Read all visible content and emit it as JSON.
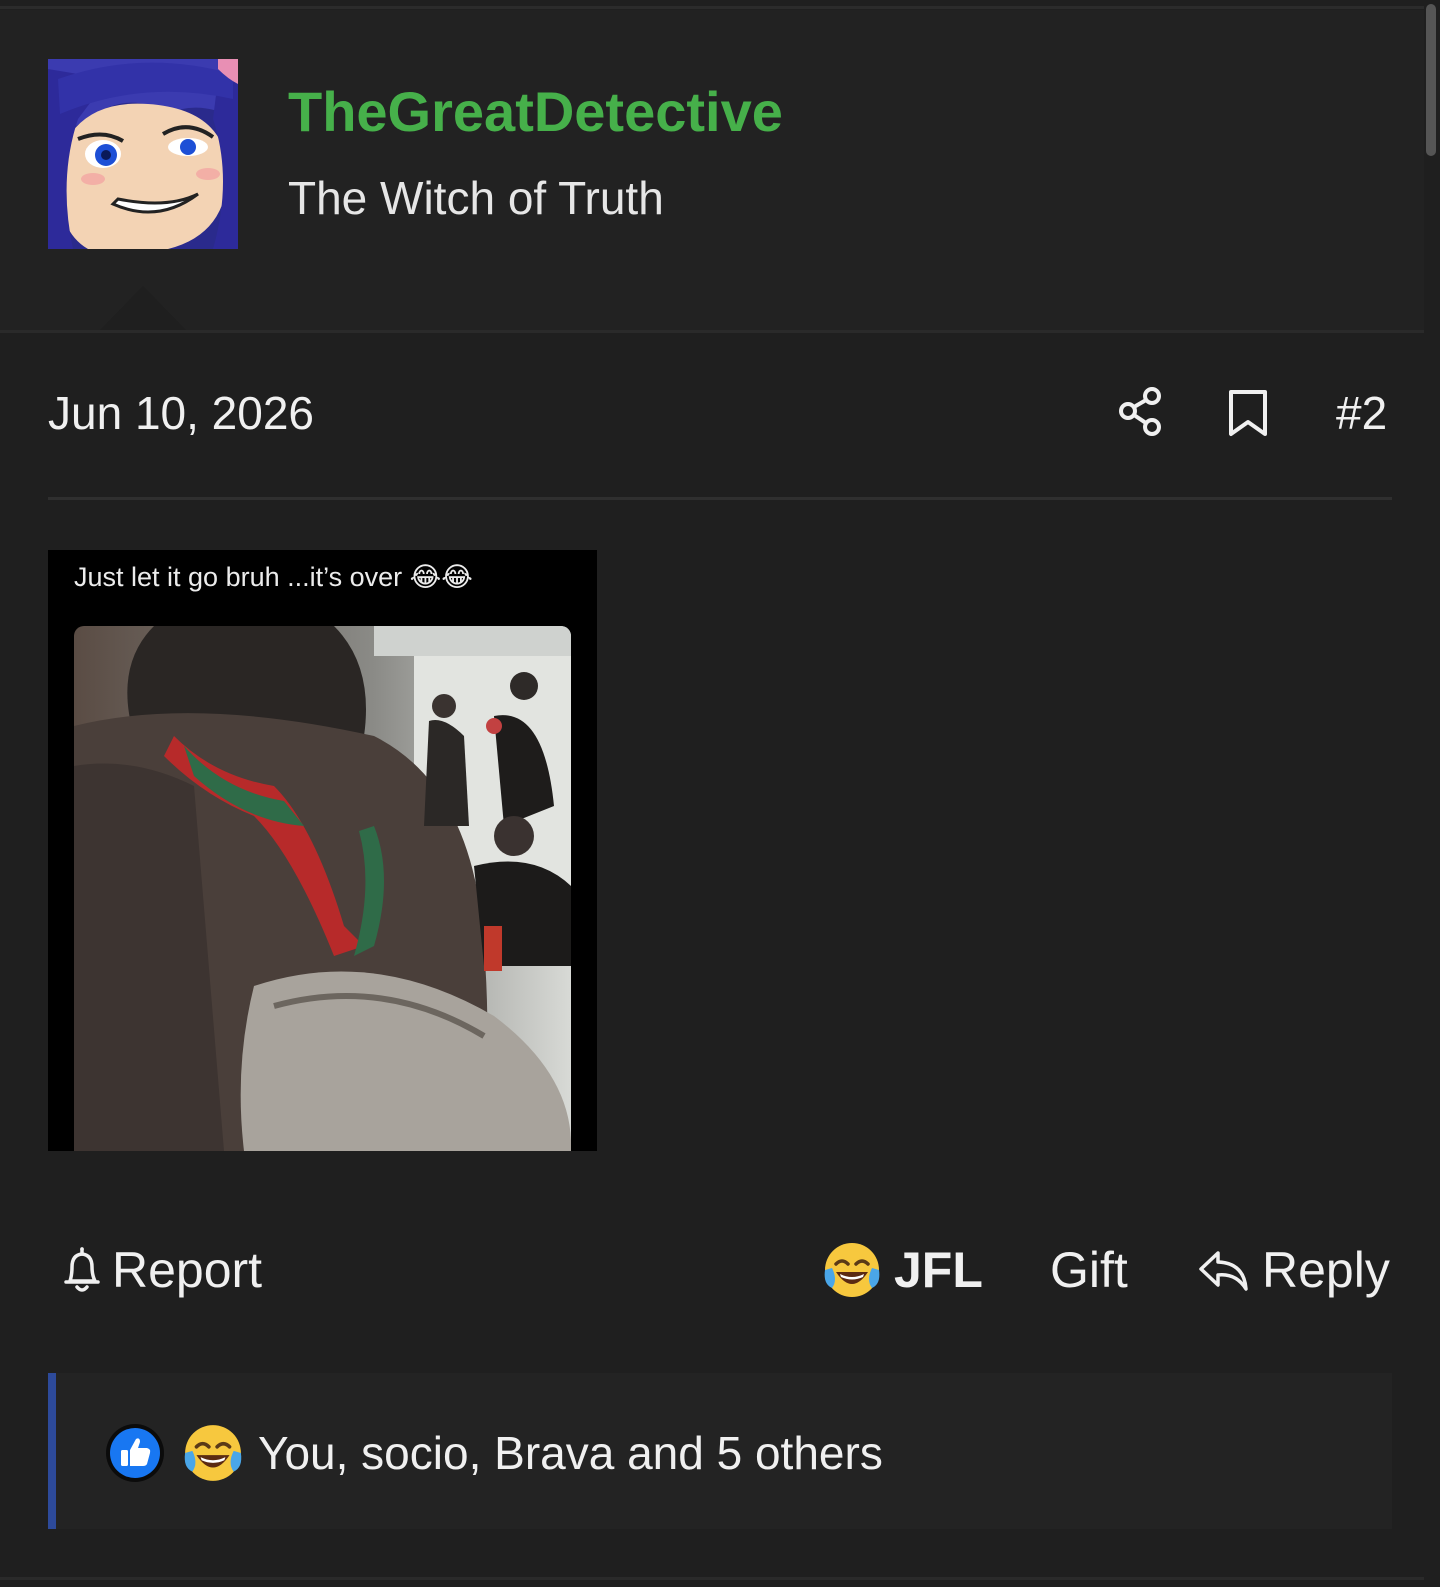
{
  "user": {
    "name": "TheGreatDetective",
    "title": "The Witch of Truth",
    "name_color": "#46b04a"
  },
  "post": {
    "date": "Jun 10, 2026",
    "number": "#2",
    "media_caption": "Just let it go bruh ...it’s over 😂😂"
  },
  "actions": {
    "report": "Report",
    "jfl": "JFL",
    "gift": "Gift",
    "reply": "Reply"
  },
  "reactions": {
    "summary": "You, socio, Brava and 5 others",
    "icons": [
      "like-icon",
      "crying-laughing-icon"
    ]
  },
  "icons": [
    "share-icon",
    "bookmark-icon",
    "bell-icon",
    "reply-arrow-icon"
  ],
  "colors": {
    "background": "#1f1f1f",
    "accent_blue": "#2d4a9a",
    "like_blue": "#1877f2"
  }
}
